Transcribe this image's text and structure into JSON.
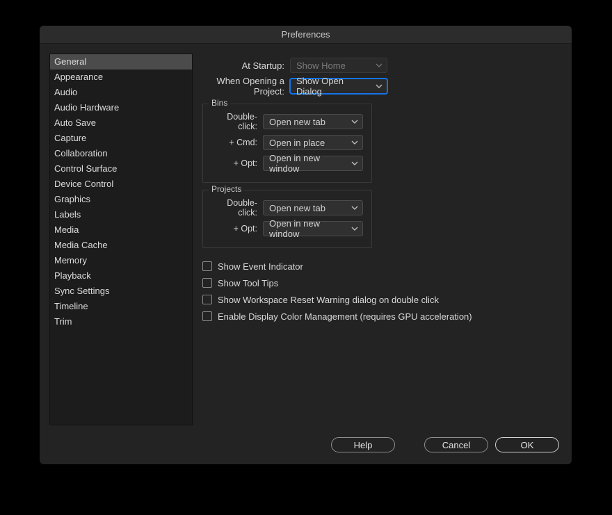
{
  "title": "Preferences",
  "sidebar": {
    "items": [
      {
        "label": "General",
        "selected": true
      },
      {
        "label": "Appearance"
      },
      {
        "label": "Audio"
      },
      {
        "label": "Audio Hardware"
      },
      {
        "label": "Auto Save"
      },
      {
        "label": "Capture"
      },
      {
        "label": "Collaboration"
      },
      {
        "label": "Control Surface"
      },
      {
        "label": "Device Control"
      },
      {
        "label": "Graphics"
      },
      {
        "label": "Labels"
      },
      {
        "label": "Media"
      },
      {
        "label": "Media Cache"
      },
      {
        "label": "Memory"
      },
      {
        "label": "Playback"
      },
      {
        "label": "Sync Settings"
      },
      {
        "label": "Timeline"
      },
      {
        "label": "Trim"
      }
    ]
  },
  "general": {
    "at_startup": {
      "label": "At Startup:",
      "value": "Show Home",
      "disabled": true
    },
    "open_project": {
      "label": "When Opening a Project:",
      "value": "Show Open Dialog",
      "focused": true
    },
    "bins": {
      "title": "Bins",
      "double_click": {
        "label": "Double-click:",
        "value": "Open new tab"
      },
      "cmd": {
        "label": "+ Cmd:",
        "value": "Open in place"
      },
      "opt": {
        "label": "+ Opt:",
        "value": "Open in new window"
      }
    },
    "projects": {
      "title": "Projects",
      "double_click": {
        "label": "Double-click:",
        "value": "Open new tab"
      },
      "opt": {
        "label": "+ Opt:",
        "value": "Open in new window"
      }
    },
    "checks": [
      {
        "label": "Show Event Indicator",
        "checked": false
      },
      {
        "label": "Show Tool Tips",
        "checked": false
      },
      {
        "label": "Show Workspace Reset Warning dialog on double click",
        "checked": false
      },
      {
        "label": "Enable Display Color Management (requires GPU acceleration)",
        "checked": false
      }
    ]
  },
  "footer": {
    "help": "Help",
    "cancel": "Cancel",
    "ok": "OK"
  }
}
